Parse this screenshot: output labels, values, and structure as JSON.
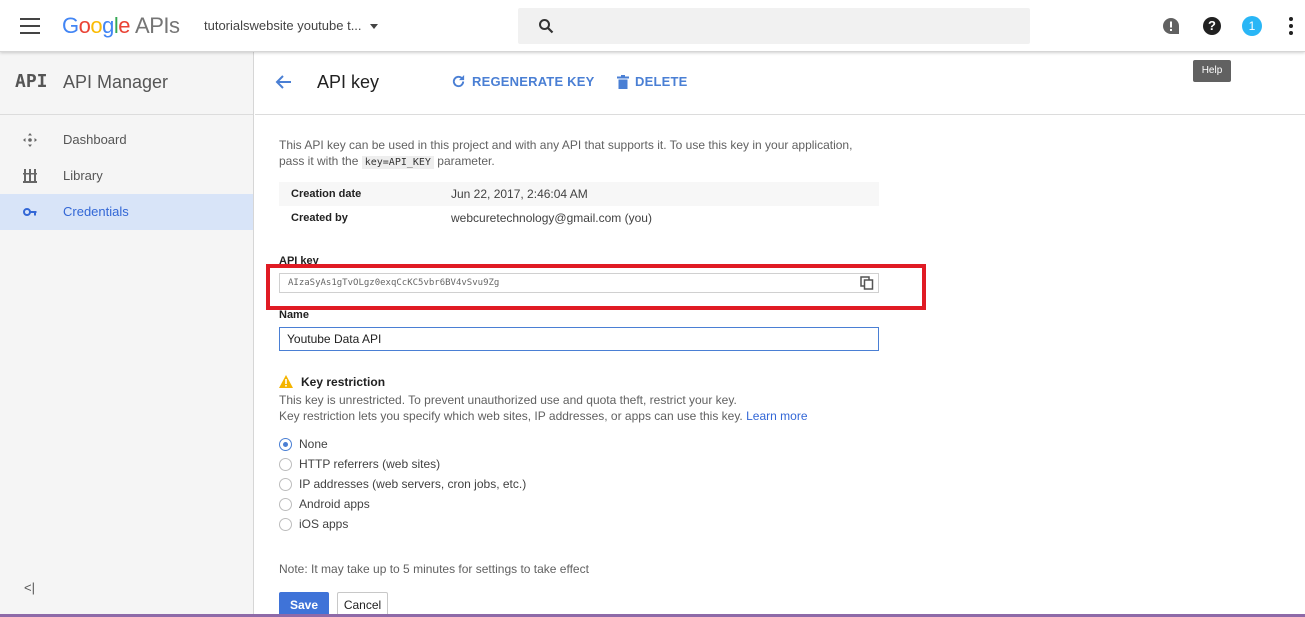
{
  "header": {
    "logo_google": [
      "G",
      "o",
      "o",
      "g",
      "l",
      "e"
    ],
    "logo_apis": "APIs",
    "project_name": "tutorialswebsite youtube t...",
    "notification_count": "1",
    "help_tooltip": "Help"
  },
  "sidebar": {
    "logo": "API",
    "title": "API Manager",
    "items": [
      {
        "label": "Dashboard",
        "icon": "dashboard-icon"
      },
      {
        "label": "Library",
        "icon": "library-icon"
      },
      {
        "label": "Credentials",
        "icon": "key-icon",
        "active": true
      }
    ],
    "collapse_label": "<|"
  },
  "main": {
    "title": "API key",
    "regenerate_label": "REGENERATE KEY",
    "delete_label": "DELETE",
    "description_1": "This API key can be used in this project and with any API that supports it. To use this key in your application,",
    "description_2a": "pass it with the",
    "description_code": "key=API_KEY",
    "description_2b": "parameter.",
    "info": [
      {
        "label": "Creation date",
        "value": "Jun 22, 2017, 2:46:04 AM"
      },
      {
        "label": "Created by",
        "value": "webcuretechnology@gmail.com (you)"
      }
    ],
    "api_key_label": "API key",
    "api_key_value": "AIzaSyAs1gTvOLgz0exqCcKC5vbr6BV4vSvu9Zg",
    "name_label": "Name",
    "name_value": "Youtube Data API",
    "key_restriction": {
      "title": "Key restriction",
      "line1": "This key is unrestricted. To prevent unauthorized use and quota theft, restrict your key.",
      "line2": "Key restriction lets you specify which web sites, IP addresses, or apps can use this key.",
      "learn_more": "Learn more",
      "options": [
        {
          "label": "None",
          "checked": true
        },
        {
          "label": "HTTP referrers (web sites)",
          "checked": false
        },
        {
          "label": "IP addresses (web servers, cron jobs, etc.)",
          "checked": false
        },
        {
          "label": "Android apps",
          "checked": false
        },
        {
          "label": "iOS apps",
          "checked": false
        }
      ]
    },
    "note": "Note: It may take up to 5 minutes for settings to take effect",
    "save_label": "Save",
    "cancel_label": "Cancel"
  },
  "colors": {
    "accent": "#4a7fd4",
    "highlight": "#e01b24",
    "badge": "#29b6f6",
    "active_bg": "#d8e4f8"
  }
}
